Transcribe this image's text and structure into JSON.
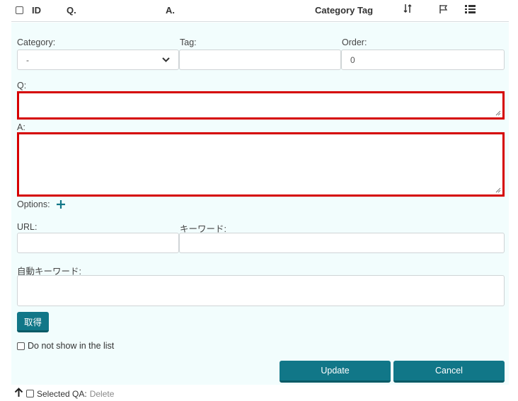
{
  "header": {
    "id_label": "ID",
    "q_label": "Q.",
    "a_label": "A.",
    "category_tag_label": "Category Tag"
  },
  "form": {
    "category_label": "Category:",
    "category_value": "-",
    "tag_label": "Tag:",
    "tag_value": "",
    "order_label": "Order:",
    "order_value": "0",
    "q_label": "Q:",
    "q_value": "",
    "a_label": "A:",
    "a_value": "",
    "options_label": "Options:",
    "url_label": "URL:",
    "url_value": "",
    "keyword_label": "キーワード:",
    "keyword_value": "",
    "auto_keyword_label": "自動キーワード:",
    "auto_keyword_value": "",
    "fetch_button": "取得",
    "hide_label": "Do not show in the list",
    "update_button": "Update",
    "cancel_button": "Cancel"
  },
  "footer": {
    "selected_label": "Selected QA:",
    "delete_label": "Delete"
  },
  "colors": {
    "accent": "#117788",
    "highlight_border": "#d50000",
    "panel_bg": "#f2fdfd"
  },
  "icons": [
    "sort-icon",
    "flag-icon",
    "list-options-icon",
    "plus-icon",
    "chevron-down-icon",
    "arrow-up-icon"
  ]
}
